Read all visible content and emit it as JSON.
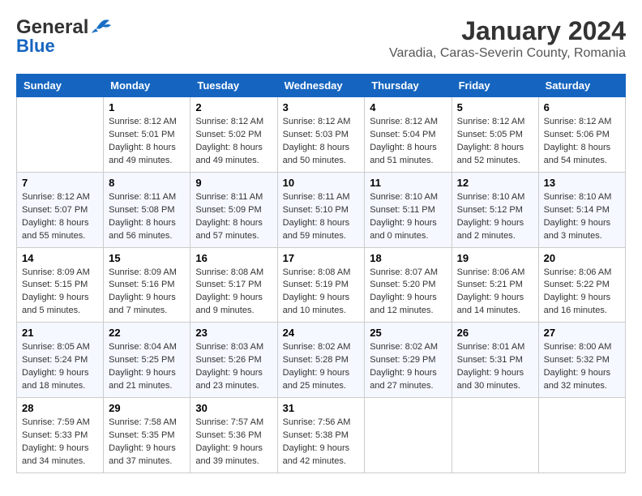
{
  "header": {
    "logo_line1": "General",
    "logo_line2": "Blue",
    "month_title": "January 2024",
    "location": "Varadia, Caras-Severin County, Romania"
  },
  "columns": [
    "Sunday",
    "Monday",
    "Tuesday",
    "Wednesday",
    "Thursday",
    "Friday",
    "Saturday"
  ],
  "weeks": [
    [
      {
        "day": "",
        "info": ""
      },
      {
        "day": "1",
        "info": "Sunrise: 8:12 AM\nSunset: 5:01 PM\nDaylight: 8 hours\nand 49 minutes."
      },
      {
        "day": "2",
        "info": "Sunrise: 8:12 AM\nSunset: 5:02 PM\nDaylight: 8 hours\nand 49 minutes."
      },
      {
        "day": "3",
        "info": "Sunrise: 8:12 AM\nSunset: 5:03 PM\nDaylight: 8 hours\nand 50 minutes."
      },
      {
        "day": "4",
        "info": "Sunrise: 8:12 AM\nSunset: 5:04 PM\nDaylight: 8 hours\nand 51 minutes."
      },
      {
        "day": "5",
        "info": "Sunrise: 8:12 AM\nSunset: 5:05 PM\nDaylight: 8 hours\nand 52 minutes."
      },
      {
        "day": "6",
        "info": "Sunrise: 8:12 AM\nSunset: 5:06 PM\nDaylight: 8 hours\nand 54 minutes."
      }
    ],
    [
      {
        "day": "7",
        "info": "Sunrise: 8:12 AM\nSunset: 5:07 PM\nDaylight: 8 hours\nand 55 minutes."
      },
      {
        "day": "8",
        "info": "Sunrise: 8:11 AM\nSunset: 5:08 PM\nDaylight: 8 hours\nand 56 minutes."
      },
      {
        "day": "9",
        "info": "Sunrise: 8:11 AM\nSunset: 5:09 PM\nDaylight: 8 hours\nand 57 minutes."
      },
      {
        "day": "10",
        "info": "Sunrise: 8:11 AM\nSunset: 5:10 PM\nDaylight: 8 hours\nand 59 minutes."
      },
      {
        "day": "11",
        "info": "Sunrise: 8:10 AM\nSunset: 5:11 PM\nDaylight: 9 hours\nand 0 minutes."
      },
      {
        "day": "12",
        "info": "Sunrise: 8:10 AM\nSunset: 5:12 PM\nDaylight: 9 hours\nand 2 minutes."
      },
      {
        "day": "13",
        "info": "Sunrise: 8:10 AM\nSunset: 5:14 PM\nDaylight: 9 hours\nand 3 minutes."
      }
    ],
    [
      {
        "day": "14",
        "info": "Sunrise: 8:09 AM\nSunset: 5:15 PM\nDaylight: 9 hours\nand 5 minutes."
      },
      {
        "day": "15",
        "info": "Sunrise: 8:09 AM\nSunset: 5:16 PM\nDaylight: 9 hours\nand 7 minutes."
      },
      {
        "day": "16",
        "info": "Sunrise: 8:08 AM\nSunset: 5:17 PM\nDaylight: 9 hours\nand 9 minutes."
      },
      {
        "day": "17",
        "info": "Sunrise: 8:08 AM\nSunset: 5:19 PM\nDaylight: 9 hours\nand 10 minutes."
      },
      {
        "day": "18",
        "info": "Sunrise: 8:07 AM\nSunset: 5:20 PM\nDaylight: 9 hours\nand 12 minutes."
      },
      {
        "day": "19",
        "info": "Sunrise: 8:06 AM\nSunset: 5:21 PM\nDaylight: 9 hours\nand 14 minutes."
      },
      {
        "day": "20",
        "info": "Sunrise: 8:06 AM\nSunset: 5:22 PM\nDaylight: 9 hours\nand 16 minutes."
      }
    ],
    [
      {
        "day": "21",
        "info": "Sunrise: 8:05 AM\nSunset: 5:24 PM\nDaylight: 9 hours\nand 18 minutes."
      },
      {
        "day": "22",
        "info": "Sunrise: 8:04 AM\nSunset: 5:25 PM\nDaylight: 9 hours\nand 21 minutes."
      },
      {
        "day": "23",
        "info": "Sunrise: 8:03 AM\nSunset: 5:26 PM\nDaylight: 9 hours\nand 23 minutes."
      },
      {
        "day": "24",
        "info": "Sunrise: 8:02 AM\nSunset: 5:28 PM\nDaylight: 9 hours\nand 25 minutes."
      },
      {
        "day": "25",
        "info": "Sunrise: 8:02 AM\nSunset: 5:29 PM\nDaylight: 9 hours\nand 27 minutes."
      },
      {
        "day": "26",
        "info": "Sunrise: 8:01 AM\nSunset: 5:31 PM\nDaylight: 9 hours\nand 30 minutes."
      },
      {
        "day": "27",
        "info": "Sunrise: 8:00 AM\nSunset: 5:32 PM\nDaylight: 9 hours\nand 32 minutes."
      }
    ],
    [
      {
        "day": "28",
        "info": "Sunrise: 7:59 AM\nSunset: 5:33 PM\nDaylight: 9 hours\nand 34 minutes."
      },
      {
        "day": "29",
        "info": "Sunrise: 7:58 AM\nSunset: 5:35 PM\nDaylight: 9 hours\nand 37 minutes."
      },
      {
        "day": "30",
        "info": "Sunrise: 7:57 AM\nSunset: 5:36 PM\nDaylight: 9 hours\nand 39 minutes."
      },
      {
        "day": "31",
        "info": "Sunrise: 7:56 AM\nSunset: 5:38 PM\nDaylight: 9 hours\nand 42 minutes."
      },
      {
        "day": "",
        "info": ""
      },
      {
        "day": "",
        "info": ""
      },
      {
        "day": "",
        "info": ""
      }
    ]
  ]
}
